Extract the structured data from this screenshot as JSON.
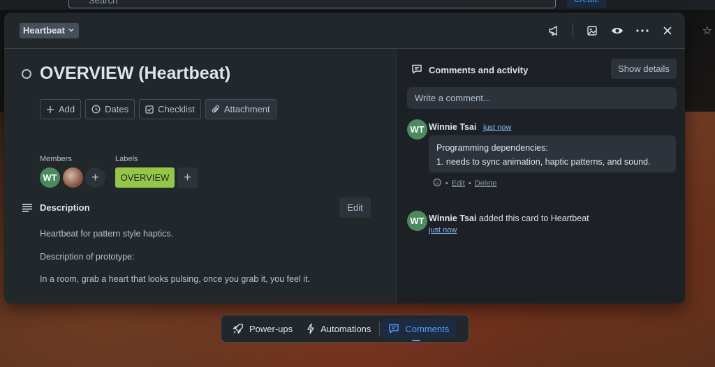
{
  "background": {
    "search_placeholder": "Search",
    "create_label": "Create"
  },
  "header": {
    "list_name": "Heartbeat"
  },
  "card": {
    "title": "OVERVIEW (Heartbeat)",
    "actions": {
      "add": "Add",
      "dates": "Dates",
      "checklist": "Checklist",
      "attachment": "Attachment"
    },
    "members_label": "Members",
    "labels_label": "Labels",
    "member_initials": "WT",
    "label_text": "OVERVIEW",
    "label_color": "#94c748",
    "description_title": "Description",
    "edit_label": "Edit",
    "description": [
      "Heartbeat for pattern style haptics.",
      "Description of prototype:",
      "In a room, grab a heart that looks pulsing, once you grab it, you feel it."
    ]
  },
  "side": {
    "title": "Comments and activity",
    "show_details": "Show details",
    "comment_placeholder": "Write a comment...",
    "comment": {
      "initials": "WT",
      "author": "Winnie Tsai",
      "time": "just now",
      "lines": [
        "Programming dependencies:",
        "1. needs to sync animation, haptic patterns, and sound."
      ],
      "edit": "Edit",
      "delete": "Delete"
    },
    "activity": {
      "initials": "WT",
      "author": "Winnie Tsai",
      "text": " added this card to Heartbeat",
      "time": "just now"
    }
  },
  "bottom_bar": {
    "powerups": "Power-ups",
    "automations": "Automations",
    "comments": "Comments"
  }
}
